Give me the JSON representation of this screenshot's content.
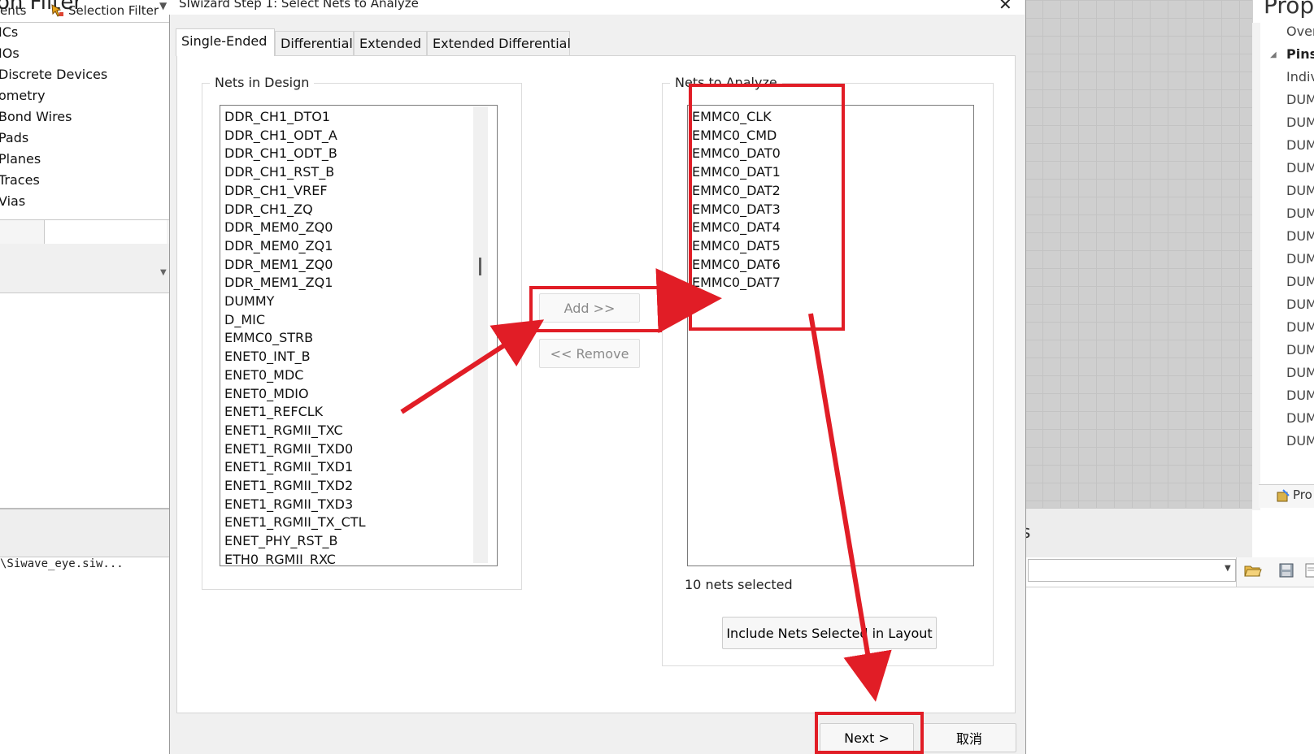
{
  "left_panel": {
    "title": "on Filter",
    "items": [
      "ICs",
      "IOs",
      "Discrete Devices",
      "ometry",
      "Bond Wires",
      "Pads",
      "Planes",
      "Traces",
      "Vias"
    ],
    "tab_partial": "ents",
    "tab_selection_filter": "Selection Filter",
    "file_path": "\\Siwave_eye.siw..."
  },
  "right_panel": {
    "title": "Prop",
    "rows": [
      "Over",
      "Pins",
      "Indiv",
      "DUM",
      "DUM",
      "DUM",
      "DUM",
      "DUM",
      "DUM",
      "DUM",
      "DUM",
      "DUM",
      "DUM",
      "DUM",
      "DUM",
      "DUM",
      "DUM",
      "DUM",
      "DUM"
    ],
    "bottom_tab": "Pro",
    "bottom_label": "s"
  },
  "dialog": {
    "title": "SIwizard Step 1: Select Nets to Analyze",
    "close_glyph": "✕",
    "tabs": [
      {
        "label": "Single-Ended"
      },
      {
        "label": "Differential"
      },
      {
        "label": "Extended"
      },
      {
        "label": "Extended Differential"
      }
    ],
    "nets_in_design": {
      "label": "Nets in Design",
      "items": [
        "DDR_CH1_DTO1",
        "DDR_CH1_ODT_A",
        "DDR_CH1_ODT_B",
        "DDR_CH1_RST_B",
        "DDR_CH1_VREF",
        "DDR_CH1_ZQ",
        "DDR_MEM0_ZQ0",
        "DDR_MEM0_ZQ1",
        "DDR_MEM1_ZQ0",
        "DDR_MEM1_ZQ1",
        "DUMMY",
        "D_MIC",
        "EMMC0_STRB",
        "ENET0_INT_B",
        "ENET0_MDC",
        "ENET0_MDIO",
        "ENET1_REFCLK",
        "ENET1_RGMII_TXC",
        "ENET1_RGMII_TXD0",
        "ENET1_RGMII_TXD1",
        "ENET1_RGMII_TXD2",
        "ENET1_RGMII_TXD3",
        "ENET1_RGMII_TX_CTL",
        "ENET_PHY_RST_B",
        "ETH0_RGMII_RXC"
      ]
    },
    "nets_to_analyze": {
      "label": "Nets to Analyze",
      "items": [
        "EMMC0_CLK",
        "EMMC0_CMD",
        "EMMC0_DAT0",
        "EMMC0_DAT1",
        "EMMC0_DAT2",
        "EMMC0_DAT3",
        "EMMC0_DAT4",
        "EMMC0_DAT5",
        "EMMC0_DAT6",
        "EMMC0_DAT7"
      ],
      "count_text": "10 nets selected"
    },
    "add_button": "Add >>",
    "remove_button": "<< Remove",
    "include_button": "Include Nets Selected in Layout",
    "next_button": "Next >",
    "cancel_button": "取消"
  },
  "annotation_color": "#e11d26"
}
